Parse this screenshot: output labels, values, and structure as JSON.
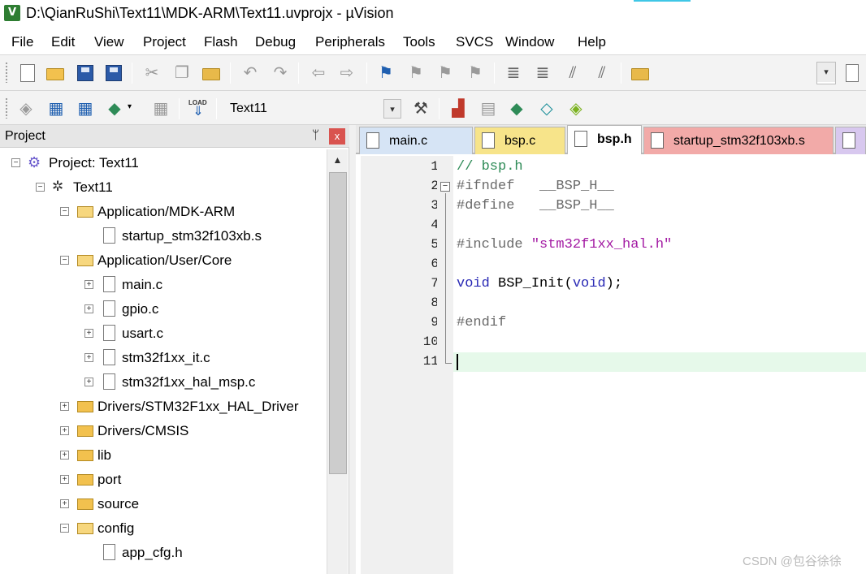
{
  "window": {
    "title": "D:\\QianRuShi\\Text11\\MDK-ARM\\Text11.uvprojx - µVision",
    "app_icon_letter": "V"
  },
  "menu": [
    "File",
    "Edit",
    "View",
    "Project",
    "Flash",
    "Debug",
    "Peripherals",
    "Tools",
    "SVCS",
    "Window",
    "Help"
  ],
  "toolbar2": {
    "target_select": "Text11",
    "load_label": "LOAD"
  },
  "project_panel": {
    "title": "Project",
    "pin_glyph": "ᛘ",
    "close_glyph": "x",
    "tree": [
      {
        "label": "Project: Text11",
        "type": "project",
        "expander": "⊟"
      },
      {
        "label": "Text11",
        "type": "target",
        "expander": "⊟"
      },
      {
        "label": "Application/MDK-ARM",
        "type": "folder-open",
        "expander": "⊟"
      },
      {
        "label": "startup_stm32f103xb.s",
        "type": "file",
        "expander": ""
      },
      {
        "label": "Application/User/Core",
        "type": "folder-open",
        "expander": "⊟"
      },
      {
        "label": "main.c",
        "type": "file",
        "expander": "⊞"
      },
      {
        "label": "gpio.c",
        "type": "file",
        "expander": "⊞"
      },
      {
        "label": "usart.c",
        "type": "file",
        "expander": "⊞"
      },
      {
        "label": "stm32f1xx_it.c",
        "type": "file",
        "expander": "⊞"
      },
      {
        "label": "stm32f1xx_hal_msp.c",
        "type": "file",
        "expander": "⊞"
      },
      {
        "label": "Drivers/STM32F1xx_HAL_Driver",
        "type": "folder",
        "expander": "⊞"
      },
      {
        "label": "Drivers/CMSIS",
        "type": "folder",
        "expander": "⊞"
      },
      {
        "label": "lib",
        "type": "folder",
        "expander": "⊞"
      },
      {
        "label": "port",
        "type": "folder",
        "expander": "⊞"
      },
      {
        "label": "source",
        "type": "folder",
        "expander": "⊞"
      },
      {
        "label": "config",
        "type": "folder-open",
        "expander": "⊟"
      },
      {
        "label": "app_cfg.h",
        "type": "file",
        "expander": ""
      }
    ]
  },
  "editor": {
    "tabs": [
      {
        "label": "main.c",
        "color": "#d6e4f5",
        "active": false
      },
      {
        "label": "bsp.c",
        "color": "#f7e48a",
        "active": false
      },
      {
        "label": "bsp.h",
        "color": "#ffffff",
        "active": true
      },
      {
        "label": "startup_stm32f103xb.s",
        "color": "#f2aaa8",
        "active": false
      },
      {
        "label": "",
        "color": "#d8c8ef",
        "active": false
      }
    ],
    "lines": [
      {
        "n": "1",
        "text": "// bsp.h",
        "cls": "c-comment"
      },
      {
        "n": "2",
        "text": "#ifndef   __BSP_H__",
        "cls": "c-pp"
      },
      {
        "n": "3",
        "text": "#define   __BSP_H__",
        "cls": "c-pp"
      },
      {
        "n": "4",
        "text": "",
        "cls": "c-id"
      },
      {
        "n": "5",
        "text": "#include \"stm32f1xx_hal.h\"",
        "cls": "c-pp"
      },
      {
        "n": "6",
        "text": "",
        "cls": "c-id"
      },
      {
        "n": "7",
        "text": "void BSP_Init(void);",
        "cls": "c-id"
      },
      {
        "n": "8",
        "text": "",
        "cls": "c-id"
      },
      {
        "n": "9",
        "text": "#endif",
        "cls": "c-pp"
      },
      {
        "n": "10",
        "text": "",
        "cls": "c-id"
      },
      {
        "n": "11",
        "text": "",
        "cls": "c-id"
      }
    ],
    "fold_glyph": "−"
  },
  "watermark": "CSDN @包谷徐徐"
}
